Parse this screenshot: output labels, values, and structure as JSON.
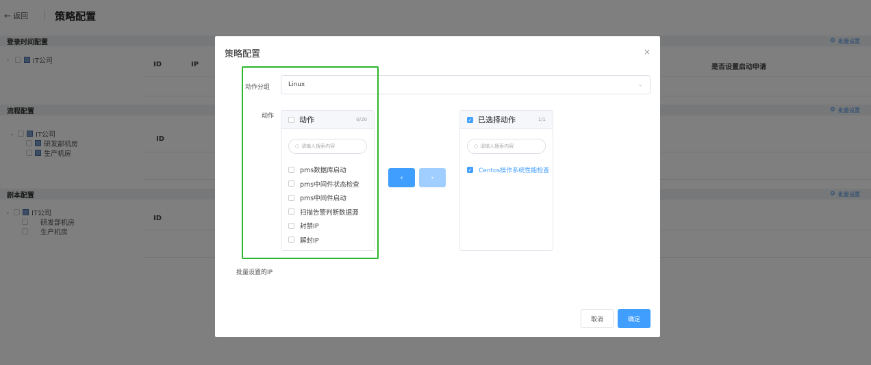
{
  "header": {
    "back_icon": "←",
    "back_label": "返回",
    "title": "策略配置"
  },
  "sections": {
    "login": {
      "title": "登录时间配置",
      "batch": "批量设置",
      "tree_root": "IT公司",
      "col_id": "ID",
      "col_ip": "IP",
      "col_apply": "是否设置启动申请"
    },
    "flow": {
      "title": "流程配置",
      "batch": "批量设置",
      "tree_root": "IT公司",
      "children": [
        "研发部机房",
        "生产机房"
      ],
      "col_id": "ID"
    },
    "script": {
      "title": "剧本配置",
      "batch": "批量设置",
      "tree_root": "IT公司",
      "children": [
        "研发部机房",
        "生产机房"
      ],
      "col_id": "ID"
    }
  },
  "modal": {
    "title": "策略配置",
    "close_icon": "×",
    "group_label": "动作分组",
    "group_value": "Linux",
    "action_label": "动作",
    "batch_ip_label": "批量设置的IP",
    "left_panel": {
      "title": "动作",
      "count": "0/20",
      "search_placeholder": "请输入搜索内容",
      "items": [
        "pms数据库启动",
        "pms中间件状态检查",
        "pms中间件启动",
        "扫描告警判断数据源",
        "封禁IP",
        "解封IP"
      ]
    },
    "right_panel": {
      "title": "已选择动作",
      "count": "1/1",
      "search_placeholder": "请输入搜索内容",
      "items": [
        "Centos操作系统性能检查"
      ]
    },
    "to_left_icon": "‹",
    "to_right_icon": "›",
    "cancel_label": "取消",
    "ok_label": "确定"
  },
  "colors": {
    "primary": "#409eff",
    "primary_disabled": "#a0cfff",
    "highlight": "#2bb52b"
  }
}
